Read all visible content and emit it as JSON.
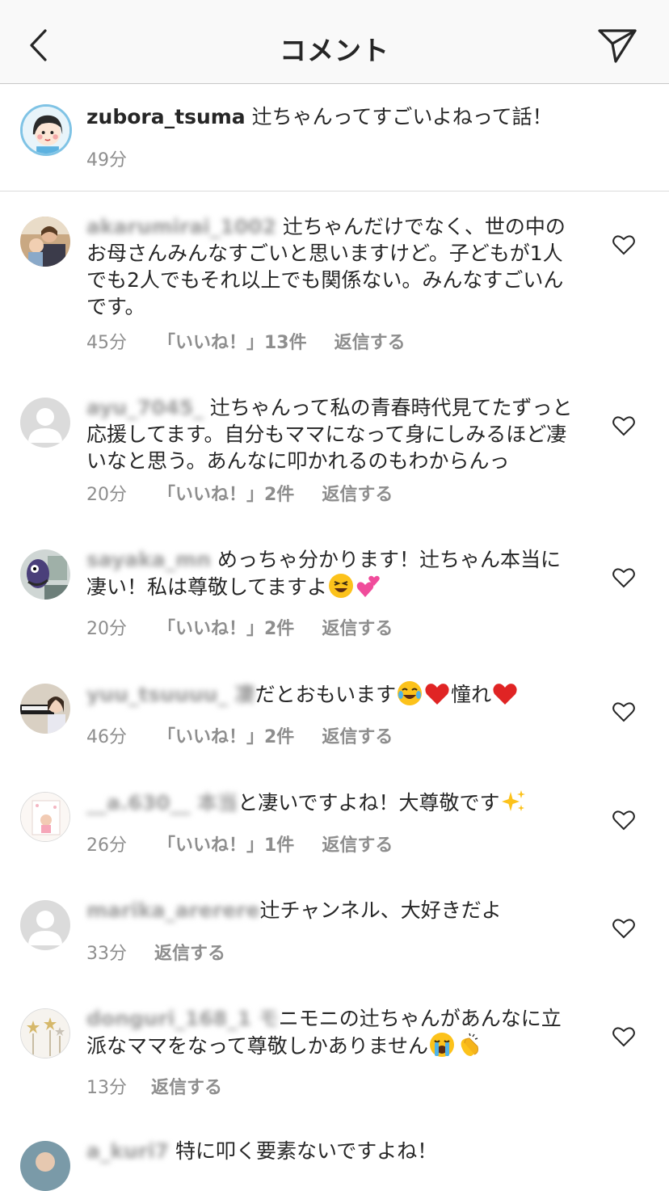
{
  "header": {
    "title": "コメント"
  },
  "caption": {
    "username": "zubora_tsuma",
    "text": " 辻ちゃんってすごいよねって話！",
    "time": "49分"
  },
  "comments": [
    {
      "username": "akarumirai_1002",
      "text": " 辻ちゃんだけでなく、世の中のお母さんみんなすごいと思いますけど。子どもが1人でも2人でもそれ以上でも関係ない。みんなすごいんです。",
      "time": "45分",
      "likes": "「いいね！」13件",
      "reply": "返信する"
    },
    {
      "username": "ayu_7045_",
      "text": " 辻ちゃんって私の青春時代見てたずっと応援してます。自分もママになって身にしみるほど凄いなと思う。あんなに叩かれるのもわからんっ",
      "time": "20分",
      "likes": "「いいね！」2件",
      "reply": "返信する"
    },
    {
      "username": "sayaka_mn",
      "text": " めっちゃ分かります！辻ちゃん本当に凄い！私は尊敬してますよ",
      "time": "20分",
      "likes": "「いいね！」2件",
      "reply": "返信する"
    },
    {
      "username": "yuu_tsuuuu_ 凄",
      "text": "だとおもいます",
      "after": "憧れ",
      "time": "46分",
      "likes": "「いいね！」2件",
      "reply": "返信する"
    },
    {
      "username": "__a.630__ 本当",
      "text": "と凄いですよね！大尊敬です",
      "time": "26分",
      "likes": "「いいね！」1件",
      "reply": "返信する"
    },
    {
      "username": "marika_arerere",
      "text": "辻チャンネル、大好きだよ",
      "time": "33分",
      "reply": "返信する"
    },
    {
      "username": "donguri_168_1 モ",
      "text": "ニモニの辻ちゃんがあんなに立派なママをなって尊敬しかありません",
      "time": "13分",
      "reply": "返信する"
    },
    {
      "username": "a_kuri7",
      "text": " 特に叩く要素ないですよね！"
    }
  ],
  "icons": {
    "back": "chevron-left-icon",
    "send": "paper-plane-icon",
    "heart": "heart-outline-icon"
  },
  "colors": {
    "text": "#262626",
    "meta": "#8e8e8e",
    "divider": "#dbdbdb",
    "header_bg": "#f9f9f9"
  }
}
